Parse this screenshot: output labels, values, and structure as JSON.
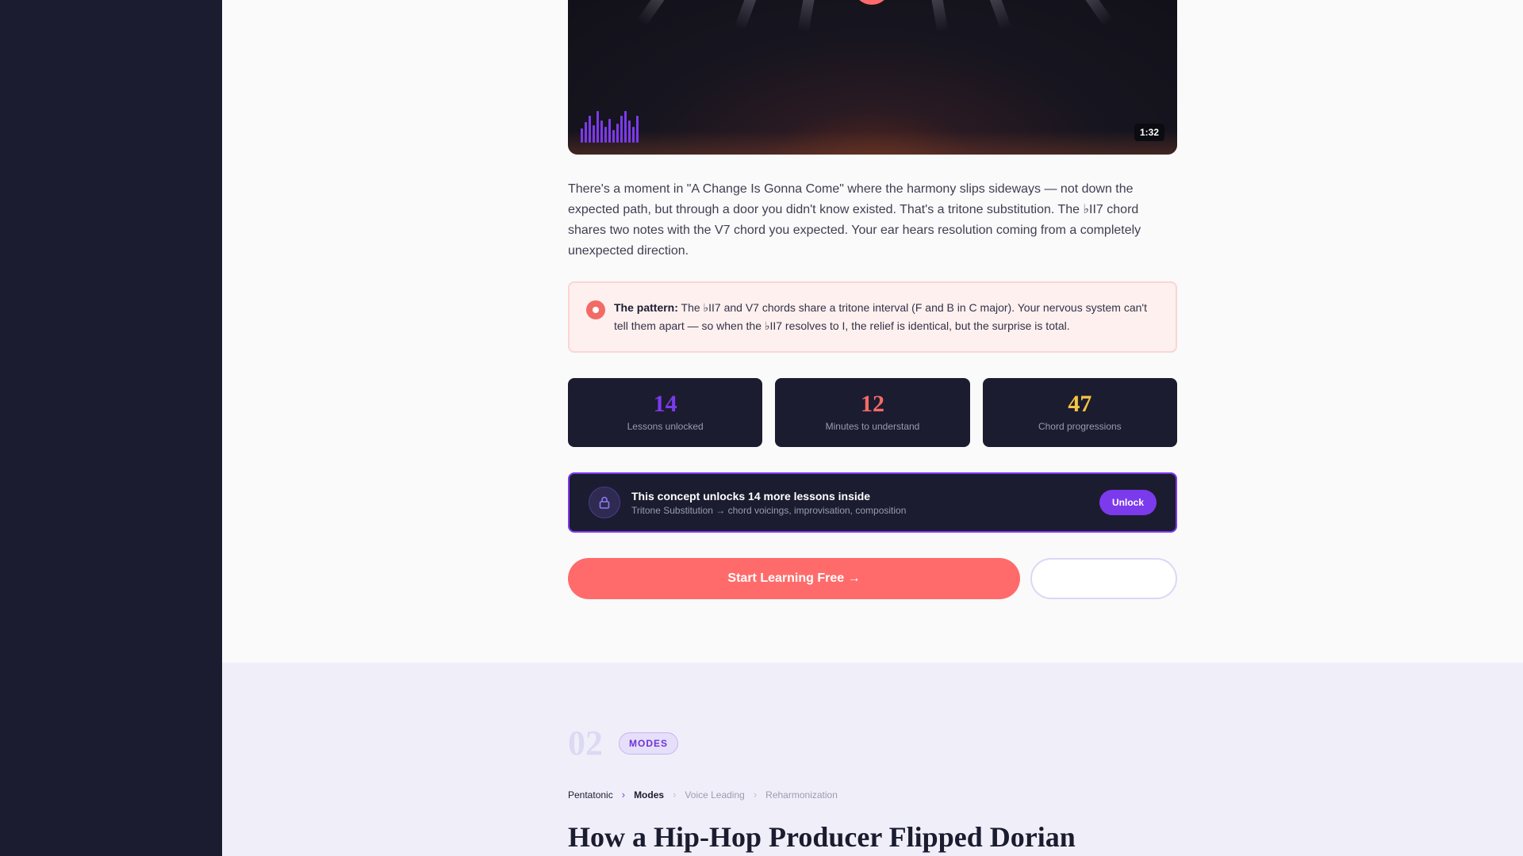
{
  "video": {
    "duration": "1:32",
    "waveform_levels": [
      0.45,
      0.65,
      0.85,
      0.55,
      1.0,
      0.7,
      0.5,
      0.75,
      0.4,
      0.6,
      0.85,
      1.0,
      0.7,
      0.5,
      0.85
    ]
  },
  "lesson": {
    "body": "There's a moment in \"A Change Is Gonna Come\" where the harmony slips sideways — not down the expected path, but through a door you didn't know existed. That's a tritone substitution. The ♭II7 chord shares two notes with the V7 chord you expected. Your ear hears resolution coming from a completely unexpected direction.",
    "callout": {
      "label": "The pattern:",
      "text": " The ♭II7 and V7 chords share a tritone interval (F and B in C major). Your nervous system can't tell them apart — so when the ♭II7 resolves to I, the relief is identical, but the surprise is total."
    },
    "stats": [
      {
        "value": "14",
        "label": "Lessons unlocked",
        "color": "#7c3aed"
      },
      {
        "value": "12",
        "label": "Minutes to understand",
        "color": "#f26b66"
      },
      {
        "value": "47",
        "label": "Chord progressions",
        "color": "#f5c542"
      }
    ],
    "unlock": {
      "title": "This concept unlocks 14 more lessons inside",
      "subtitle": "Tritone Substitution → chord voicings, improvisation, composition",
      "button": "Unlock"
    },
    "cta": {
      "primary": "Start Learning Free →",
      "secondary": ""
    }
  },
  "next_section": {
    "number": "02",
    "badge": "MODES",
    "breadcrumb": [
      "Pentatonic",
      "Modes",
      "Voice Leading",
      "Reharmonization"
    ],
    "title": "How a Hip-Hop Producer Flipped Dorian"
  },
  "colors": {
    "accent_coral": "#ff6b6b",
    "accent_purple": "#7c3aed",
    "navy": "#1c1c30"
  }
}
